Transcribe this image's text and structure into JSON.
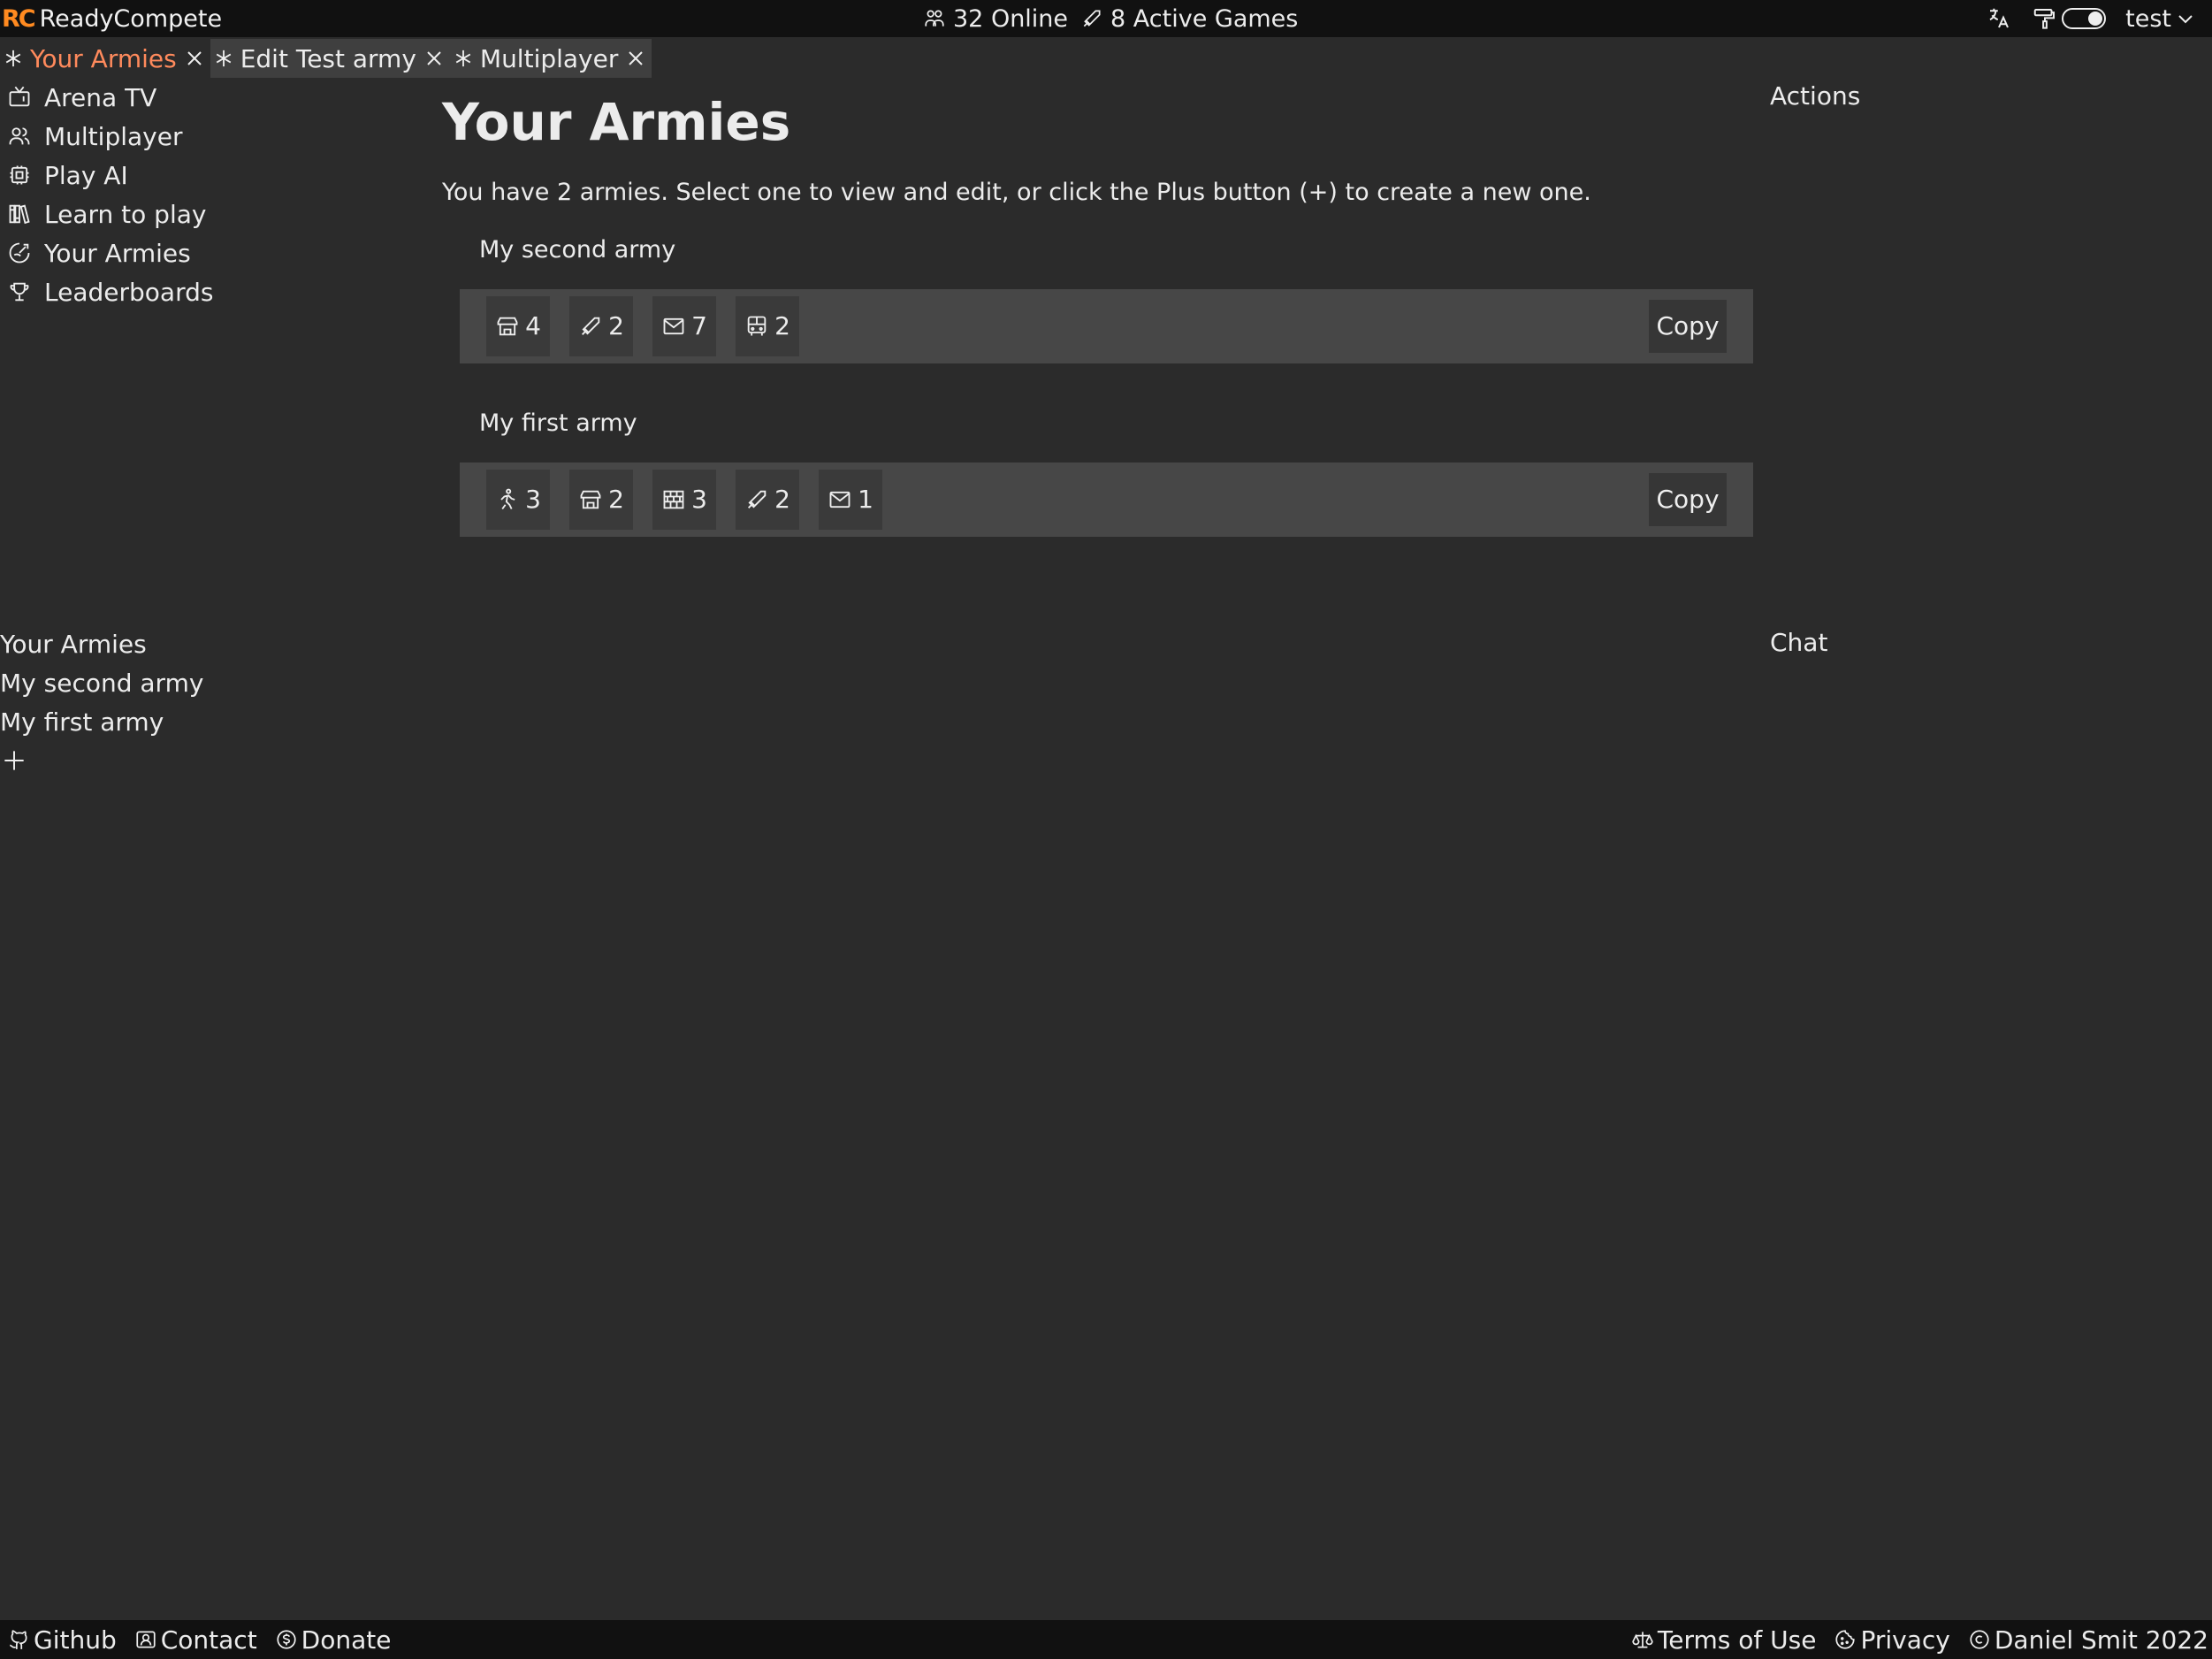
{
  "brand": {
    "logo": "RC",
    "name": "ReadyCompete"
  },
  "stats": {
    "online": "32 Online",
    "games": "8 Active Games"
  },
  "user": {
    "name": "test"
  },
  "tabs": [
    {
      "label": "Your Armies"
    },
    {
      "label": "Edit Test army"
    },
    {
      "label": "Multiplayer"
    }
  ],
  "nav": [
    {
      "label": "Arena TV",
      "icon": "tv-icon"
    },
    {
      "label": "Multiplayer",
      "icon": "users-icon"
    },
    {
      "label": "Play AI",
      "icon": "cpu-icon"
    },
    {
      "label": "Learn to play",
      "icon": "books-icon"
    },
    {
      "label": "Your Armies",
      "icon": "army-icon"
    },
    {
      "label": "Leaderboards",
      "icon": "trophy-icon"
    }
  ],
  "main": {
    "title": "Your Armies",
    "intro": "You have 2 armies. Select one to view and edit, or click the Plus button (+) to create a new one.",
    "copy_label": "Copy",
    "armies": [
      {
        "name": "My second army",
        "units": [
          {
            "icon": "building-store-icon",
            "count": "4"
          },
          {
            "icon": "sword-icon",
            "count": "2"
          },
          {
            "icon": "mail-icon",
            "count": "7"
          },
          {
            "icon": "bus-icon",
            "count": "2"
          }
        ]
      },
      {
        "name": "My first army",
        "units": [
          {
            "icon": "walk-icon",
            "count": "3"
          },
          {
            "icon": "building-store-icon",
            "count": "2"
          },
          {
            "icon": "wall-icon",
            "count": "3"
          },
          {
            "icon": "sword-icon",
            "count": "2"
          },
          {
            "icon": "mail-icon",
            "count": "1"
          }
        ]
      }
    ]
  },
  "side": {
    "actions": "Actions",
    "chat": "Chat"
  },
  "army_list": {
    "header": "Your Armies",
    "items": [
      "My second army",
      "My first army"
    ],
    "add": "+"
  },
  "footer": {
    "github": "Github",
    "contact": "Contact",
    "donate": "Donate",
    "terms": "Terms of Use",
    "privacy": "Privacy",
    "copyright": "Daniel Smit 2022"
  },
  "colors": {
    "accent": "#ff8a5c",
    "brand": "#ff8a20",
    "bar": "#111111",
    "bg": "#2b2b2b"
  }
}
